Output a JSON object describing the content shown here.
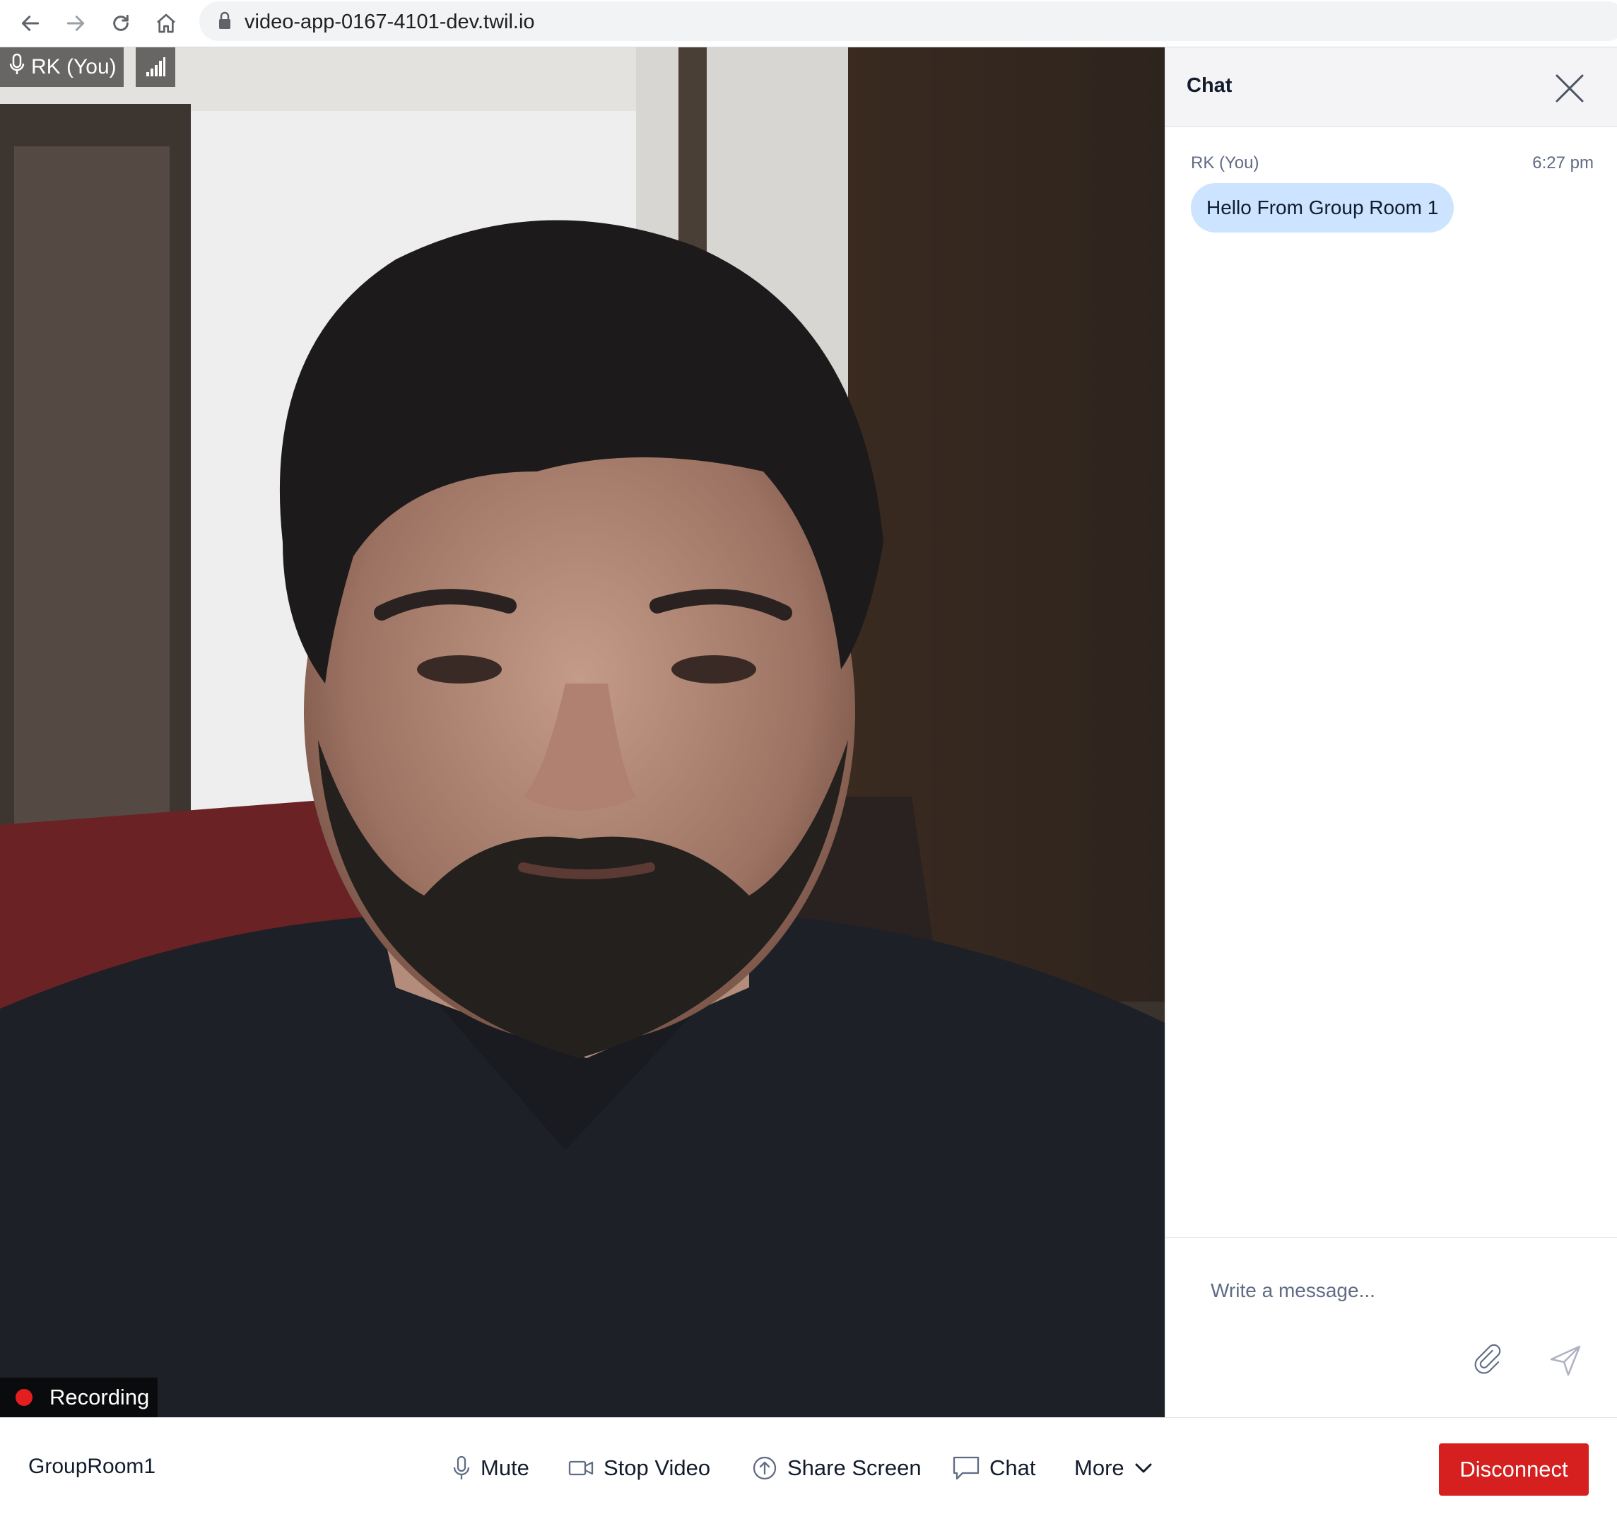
{
  "browser": {
    "url": "video-app-0167-4101-dev.twil.io"
  },
  "video": {
    "participant_label": "RK (You)",
    "recording_label": "Recording"
  },
  "chat": {
    "title": "Chat",
    "messages": [
      {
        "author": "RK (You)",
        "time": "6:27 pm",
        "text": "Hello From Group Room 1"
      }
    ],
    "input_placeholder": "Write a message..."
  },
  "controls": {
    "room_name": "GroupRoom1",
    "mute_label": "Mute",
    "stop_video_label": "Stop Video",
    "share_screen_label": "Share Screen",
    "chat_label": "Chat",
    "more_label": "More",
    "disconnect_label": "Disconnect"
  },
  "icons": {
    "back": "arrow-left-icon",
    "forward": "arrow-right-icon",
    "reload": "reload-icon",
    "home": "home-icon",
    "lock": "lock-icon",
    "mic": "microphone-icon",
    "signal": "network-quality-icon",
    "close": "close-icon",
    "attach": "paperclip-icon",
    "send": "send-icon",
    "video": "video-camera-icon",
    "share": "share-screen-icon",
    "chat": "chat-bubble-icon",
    "chevron": "chevron-down-icon"
  },
  "colors": {
    "disconnect_bg": "#d61f1f",
    "bubble_bg": "#cce4ff",
    "recording_dot": "#e31e1e"
  }
}
